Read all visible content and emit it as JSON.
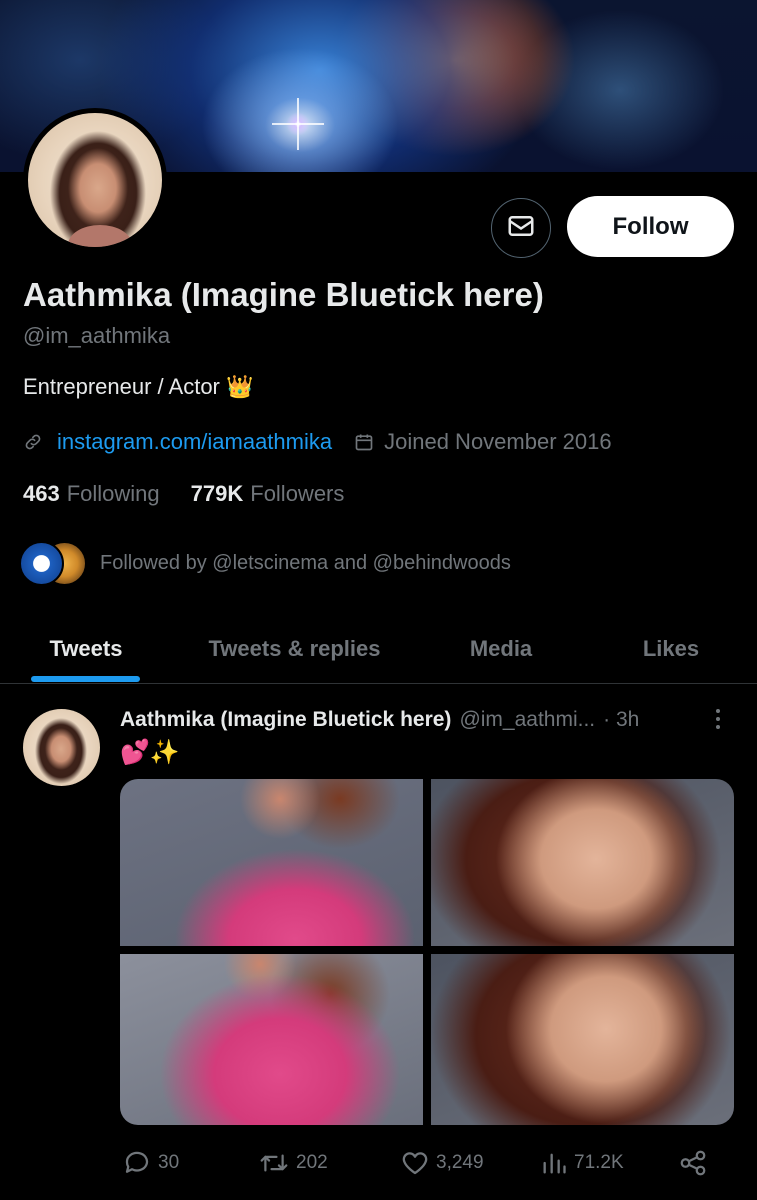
{
  "profile": {
    "display_name": "Aathmika (Imagine Bluetick here)",
    "handle": "@im_aathmika",
    "bio": "Entrepreneur / Actor 👑",
    "website": "instagram.com/iamaathmika",
    "joined": "Joined November 2016",
    "following_count": "463",
    "following_label": "Following",
    "followers_count": "779K",
    "followers_label": "Followers",
    "followed_by": "Followed by @letscinema and @behindwoods"
  },
  "header": {
    "follow_label": "Follow"
  },
  "tabs": [
    {
      "label": "Tweets",
      "active": true
    },
    {
      "label": "Tweets & replies",
      "active": false
    },
    {
      "label": "Media",
      "active": false
    },
    {
      "label": "Likes",
      "active": false
    }
  ],
  "tweet": {
    "author_name": "Aathmika (Imagine Bluetick here)",
    "author_handle": "@im_aathmi...",
    "time": "· 3h",
    "text": "💕✨",
    "replies": "30",
    "retweets": "202",
    "likes": "3,249",
    "views": "71.2K"
  },
  "colors": {
    "accent": "#1d9bf0",
    "text_primary": "#e7e9ea",
    "text_secondary": "#71767b",
    "background": "#000000"
  },
  "icons": [
    "mail-icon",
    "link-icon",
    "calendar-icon",
    "more-icon",
    "reply-icon",
    "retweet-icon",
    "like-icon",
    "views-icon",
    "share-icon"
  ]
}
